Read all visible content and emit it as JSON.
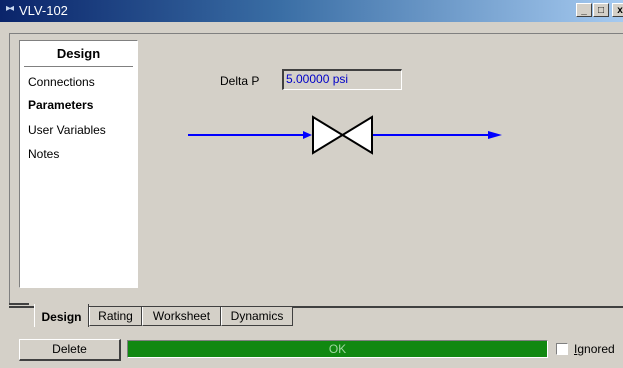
{
  "window": {
    "title": "VLV-102",
    "title_icon": "▸◂",
    "controls": {
      "minimize": "_",
      "maximize": "□",
      "close": "x"
    }
  },
  "nav": {
    "header": "Design",
    "items": [
      {
        "label": "Connections",
        "active": false
      },
      {
        "label": "Parameters",
        "active": true
      },
      {
        "label": "User Variables",
        "active": false
      },
      {
        "label": "Notes",
        "active": false
      }
    ]
  },
  "parameters": {
    "delta_p_label": "Delta P",
    "delta_p_value": "5.00000 psi"
  },
  "diagram": {
    "element": "valve",
    "stream_color": "#0000ff"
  },
  "tabs": [
    {
      "label": "Design",
      "active": true
    },
    {
      "label": "Rating",
      "active": false
    },
    {
      "label": "Worksheet",
      "active": false
    },
    {
      "label": "Dynamics",
      "active": false
    }
  ],
  "footer": {
    "delete_label": "Delete",
    "status_text": "OK",
    "status_color": "#118811",
    "ignored_first": "I",
    "ignored_rest": "gnored",
    "ignored_checked": false
  }
}
